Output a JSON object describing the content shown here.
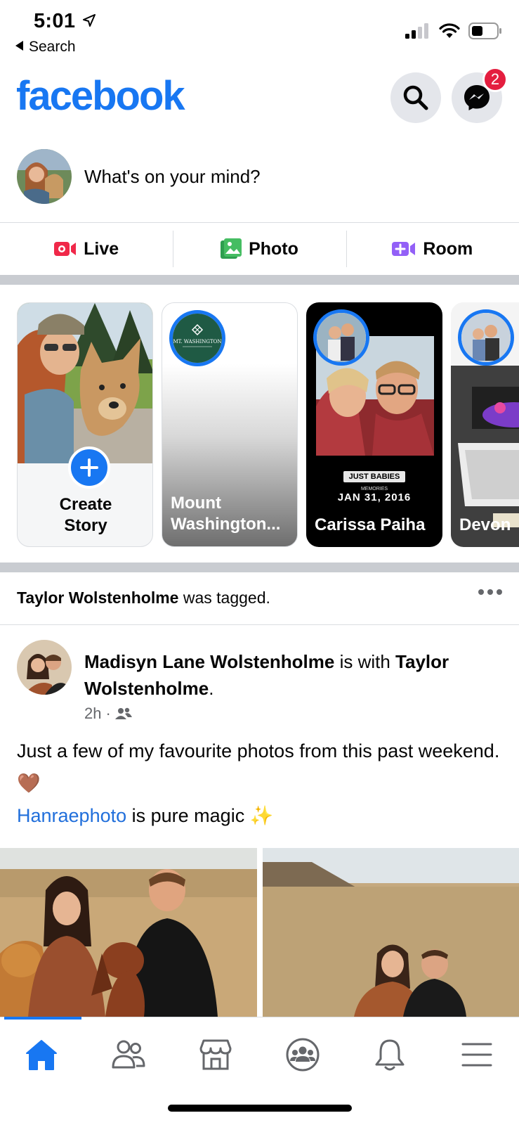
{
  "status_bar": {
    "time": "5:01",
    "back_label": "Search"
  },
  "header": {
    "logo": "facebook",
    "messenger_badge": "2"
  },
  "composer": {
    "placeholder": "What's on your mind?"
  },
  "actions": [
    {
      "label": "Live",
      "icon": "live-video-icon",
      "color": "#f02849"
    },
    {
      "label": "Photo",
      "icon": "photo-icon",
      "color": "#45bd62"
    },
    {
      "label": "Room",
      "icon": "room-icon",
      "color": "#9360f7"
    }
  ],
  "stories": {
    "create_line1": "Create",
    "create_line2": "Story",
    "items": [
      {
        "name": "Mount Washington..."
      },
      {
        "name": "Carissa Paiha"
      },
      {
        "name": "Devon"
      }
    ],
    "story_caption_1": "JUST BABIES",
    "story_caption_2": "MEMORIES",
    "story_caption_3": "JAN 31, 2016",
    "mt_washington_logo": "MT. WASHINGTON"
  },
  "post": {
    "tagged_name": "Taylor Wolstenholme",
    "tagged_suffix": " was tagged.",
    "author": "Madisyn Lane Wolstenholme",
    "with_text": " is with ",
    "with_name": "Taylor Wolstenholme",
    "period": ".",
    "time": "2h",
    "dot": "·",
    "body_line": "Just a few of my favourite photos from this past weekend.🤎",
    "link_text": "Hanraephoto",
    "link_suffix": " is pure magic ✨"
  },
  "colors": {
    "brand": "#1877f2",
    "badge": "#e41e3f",
    "link": "#216fdb"
  }
}
